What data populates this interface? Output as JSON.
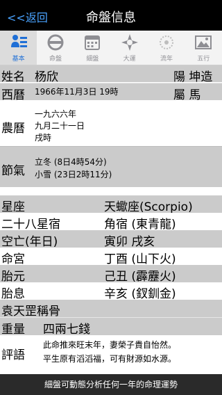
{
  "nav": {
    "back_label": "<<返回",
    "title": "命盤信息"
  },
  "tabs": [
    {
      "label": "基本",
      "icon": "profile-icon",
      "active": true
    },
    {
      "label": "命盤",
      "icon": "ring-icon"
    },
    {
      "label": "細盤",
      "icon": "calendar-icon"
    },
    {
      "label": "大運",
      "icon": "compass-icon"
    },
    {
      "label": "流年",
      "icon": "sun-icon"
    },
    {
      "label": "五行",
      "icon": "landscape-icon"
    }
  ],
  "basic": {
    "name_label": "姓名",
    "name_value": "杨欣",
    "gender_value": "陽 坤造",
    "western_label": "西曆",
    "western_value": "1966年11月3日 19時",
    "zodiac_animal": "屬 馬",
    "lunar_label": "農曆",
    "lunar_lines": [
      "一九六六年",
      "九月二十一日",
      "戌時"
    ],
    "solar_term_label": "節氣",
    "solar_terms": [
      "立冬 (8日4時54分)",
      "小雪 (23日2時11分)"
    ]
  },
  "stars": [
    {
      "label": "星座",
      "value": "天蠍座(Scorpio)",
      "shade": "gray"
    },
    {
      "label": "二十八星宿",
      "value": "角宿 (東青龍)",
      "shade": "white"
    },
    {
      "label": "空亡(年日)",
      "value": "寅卯 戌亥",
      "shade": "gray"
    },
    {
      "label": "命宮",
      "value": "丁酉 (山下火)",
      "shade": "white"
    },
    {
      "label": "胎元",
      "value": "己丑 (霹靂火)",
      "shade": "gray"
    },
    {
      "label": "胎息",
      "value": "辛亥 (釵釧金)",
      "shade": "white"
    }
  ],
  "bone": {
    "section_title": "袁天罡稱骨",
    "weight_label": "重量",
    "weight_value": "四兩七錢",
    "comment_label": "評語",
    "comment_lines": [
      "此命推來旺末年，妻榮子貴自怡然。",
      "平生原有滔滔福，可有財源如水源。"
    ]
  },
  "footer": {
    "text": "細盤可動態分析任何一年的命理運勢"
  },
  "colors": {
    "accent": "#1f6fd6",
    "back_link": "#4aa3ff",
    "row_gray": "#cbcbcb"
  }
}
